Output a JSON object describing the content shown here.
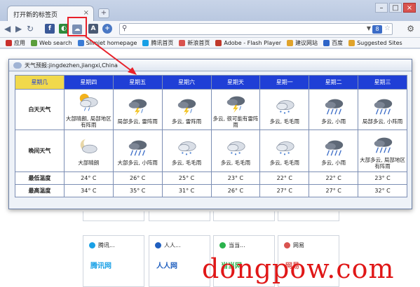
{
  "browser": {
    "tab_title": "打开新的标签页",
    "tab_close": "×",
    "newtab": "+",
    "window_buttons": [
      "–",
      "□",
      "×"
    ],
    "nav": [
      "◀",
      "▶",
      "↻"
    ],
    "extensions": [
      {
        "name": "facebook",
        "label": "f",
        "color": "#3b5998"
      },
      {
        "name": "globe",
        "label": "◐",
        "color": "#2f8a3b"
      },
      {
        "name": "weather",
        "label": "☁",
        "color": "#7a8fb3"
      },
      {
        "name": "adobe",
        "label": "A",
        "color": "#4a5a74"
      },
      {
        "name": "zoom",
        "label": "+",
        "color": "#4a78c4"
      }
    ],
    "omnibox_value": "",
    "omnibox_badge": "8",
    "bookmarks": [
      {
        "label": "应用",
        "color": "#c9302c"
      },
      {
        "label": "Web search",
        "color": "#5a9e3c"
      },
      {
        "label": "Slimjet homepage",
        "color": "#3a7bd5"
      },
      {
        "label": "腾讯首页",
        "color": "#18a0e6"
      },
      {
        "label": "新浪首页",
        "color": "#d9534f"
      },
      {
        "label": "Adobe - Flash Player",
        "color": "#c0392b"
      },
      {
        "label": "建议网站",
        "color": "#e0a32b"
      },
      {
        "label": "百度",
        "color": "#2d64c8"
      },
      {
        "label": "Suggested Sites",
        "color": "#e0a32b"
      }
    ]
  },
  "weather": {
    "header_title": "天气预报:jingdezhen,jiangxi,China",
    "days": [
      "星期几",
      "星期四",
      "星期五",
      "星期六",
      "星期天",
      "星期一",
      "星期二",
      "星期三"
    ],
    "row_labels": {
      "day": "白天天气",
      "night": "晚间天气",
      "low": "最低温度",
      "high": "最高温度"
    },
    "day_conditions": [
      {
        "icon": "sun-rain-icon",
        "text": "大部晴朗, 局部地区有阵雨"
      },
      {
        "icon": "thunderstorm-icon",
        "text": "局部多云, 雷阵雨"
      },
      {
        "icon": "thunderstorm-icon",
        "text": "多云, 雷阵雨"
      },
      {
        "icon": "thunderstorm-icon",
        "text": "多云, 很可能有雷阵雨"
      },
      {
        "icon": "drizzle-icon",
        "text": "多云, 毛毛雨"
      },
      {
        "icon": "rain-icon",
        "text": "多云, 小雨"
      },
      {
        "icon": "rain-icon",
        "text": "局部多云, 小阵雨"
      }
    ],
    "night_conditions": [
      {
        "icon": "moon-cloud-icon",
        "text": "大部晴朗"
      },
      {
        "icon": "rain-icon",
        "text": "大部多云, 小阵雨"
      },
      {
        "icon": "drizzle-icon",
        "text": "多云, 毛毛雨"
      },
      {
        "icon": "drizzle-icon",
        "text": "多云, 毛毛雨"
      },
      {
        "icon": "drizzle-icon",
        "text": "多云, 毛毛雨"
      },
      {
        "icon": "rain-icon",
        "text": "多云, 小雨"
      },
      {
        "icon": "rain-icon",
        "text": "大部多云, 局部地区有阵雨"
      }
    ],
    "low_temps": [
      "24° C",
      "26° C",
      "25° C",
      "23° C",
      "22° C",
      "22° C",
      "23° C"
    ],
    "high_temps": [
      "34° C",
      "35° C",
      "31° C",
      "26° C",
      "27° C",
      "27° C",
      "32° C"
    ]
  },
  "new_tab_thumbs": [
    {
      "title": "腾讯...",
      "logo": "腾讯网",
      "color": "#18a0e6"
    },
    {
      "title": "人人...",
      "logo": "人人网",
      "color": "#1f5fbf"
    },
    {
      "title": "当当...",
      "logo": "当当网",
      "color": "#2bb24c"
    },
    {
      "title": "网易",
      "logo": "网易",
      "color": "#d9534f"
    }
  ],
  "watermark": "dongpow.com"
}
